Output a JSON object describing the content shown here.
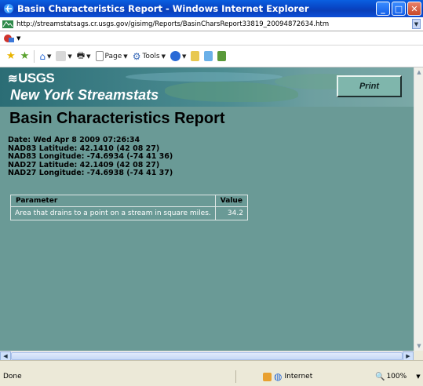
{
  "window": {
    "title": "Basin Characteristics Report - Windows Internet Explorer",
    "controls": [
      "minimize",
      "maximize",
      "close"
    ]
  },
  "address_bar": {
    "url": "http://streamstatsags.cr.usgs.gov/gisimg/Reports/BasinCharsReport33819_20094872634.htm"
  },
  "command_bar": {
    "page_label": "Page",
    "tools_label": "Tools"
  },
  "page": {
    "logo_text": "USGS",
    "site_title": "New York Streamstats",
    "print_label": "Print",
    "report_title": "Basin Characteristics Report",
    "meta_lines": [
      "Date: Wed Apr 8 2009 07:26:34",
      "NAD83 Latitude: 42.1410 (42 08 27)",
      "NAD83 Longitude: -74.6934 (-74 41 36)",
      "NAD27 Latitude: 42.1409 (42 08 27)",
      "NAD27 Longitude: -74.6938 (-74 41 37)"
    ],
    "table": {
      "headers": [
        "Parameter",
        "Value"
      ],
      "rows": [
        {
          "parameter": "Area that drains to a point on a stream in square miles.",
          "value": "34.2"
        }
      ]
    }
  },
  "status_bar": {
    "status": "Done",
    "zone": "Internet",
    "zoom": "100%"
  },
  "colors": {
    "page_background": "#6a9a96",
    "title_bar": "#0a48c8"
  }
}
